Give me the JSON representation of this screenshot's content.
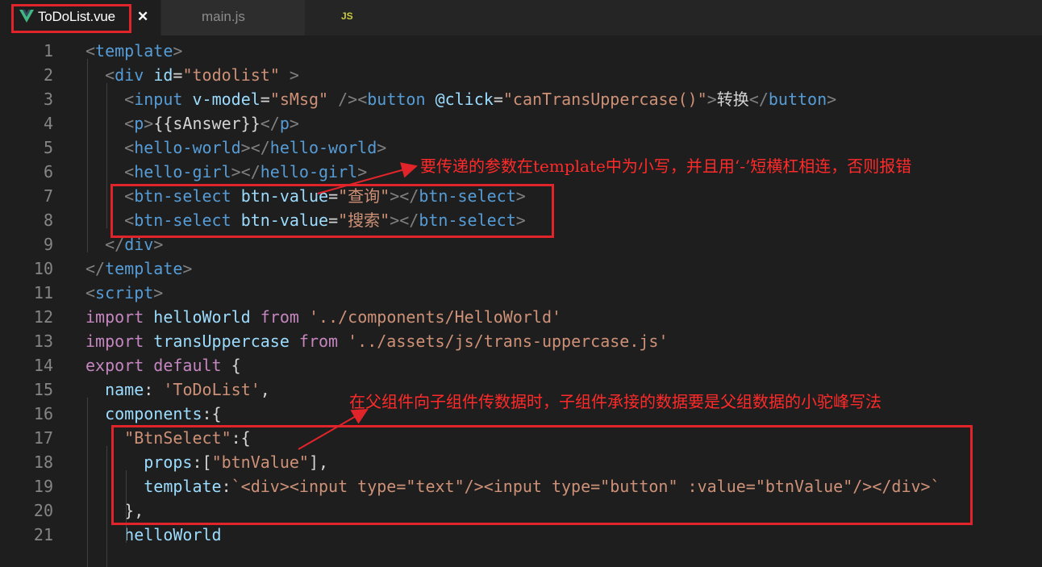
{
  "tabs": [
    {
      "label": "ToDoList.vue",
      "icon": "vue-icon",
      "active": true,
      "close_glyph": "✕"
    },
    {
      "label": "main.js",
      "icon_text": "JS",
      "active": false
    }
  ],
  "colors": {
    "editor_bg": "#1e1e1e",
    "annotation_red": "#e0242a",
    "tag": "#569cd6",
    "attribute": "#9cdcfe",
    "string": "#ce9178",
    "keyword": "#c586c0"
  },
  "code_lines": [
    {
      "n": "1",
      "tokens": [
        [
          "t-punc",
          "<"
        ],
        [
          "t-tag",
          "template"
        ],
        [
          "t-punc",
          ">"
        ]
      ]
    },
    {
      "n": "2",
      "tokens": [
        [
          "t-txt",
          "  "
        ],
        [
          "t-punc",
          "<"
        ],
        [
          "t-tag",
          "div"
        ],
        [
          "t-txt",
          " "
        ],
        [
          "t-attr",
          "id"
        ],
        [
          "t-txt",
          "="
        ],
        [
          "t-str",
          "\"todolist\""
        ],
        [
          "t-txt",
          " "
        ],
        [
          "t-punc",
          ">"
        ]
      ]
    },
    {
      "n": "3",
      "tokens": [
        [
          "t-txt",
          "    "
        ],
        [
          "t-punc",
          "<"
        ],
        [
          "t-tag",
          "input"
        ],
        [
          "t-txt",
          " "
        ],
        [
          "t-attr",
          "v-model"
        ],
        [
          "t-txt",
          "="
        ],
        [
          "t-str",
          "\"sMsg\""
        ],
        [
          "t-txt",
          " "
        ],
        [
          "t-punc",
          "/>"
        ],
        [
          "t-punc",
          "<"
        ],
        [
          "t-tag",
          "button"
        ],
        [
          "t-txt",
          " "
        ],
        [
          "t-attr",
          "@click"
        ],
        [
          "t-txt",
          "="
        ],
        [
          "t-str",
          "\"canTransUppercase()\""
        ],
        [
          "t-punc",
          ">"
        ],
        [
          "t-txt",
          "转换"
        ],
        [
          "t-punc",
          "</"
        ],
        [
          "t-tag",
          "button"
        ],
        [
          "t-punc",
          ">"
        ]
      ]
    },
    {
      "n": "4",
      "tokens": [
        [
          "t-txt",
          "    "
        ],
        [
          "t-punc",
          "<"
        ],
        [
          "t-tag",
          "p"
        ],
        [
          "t-punc",
          ">"
        ],
        [
          "t-txt",
          "{{sAnswer}}"
        ],
        [
          "t-punc",
          "</"
        ],
        [
          "t-tag",
          "p"
        ],
        [
          "t-punc",
          ">"
        ]
      ]
    },
    {
      "n": "5",
      "tokens": [
        [
          "t-txt",
          "    "
        ],
        [
          "t-punc",
          "<"
        ],
        [
          "t-tag",
          "hello-world"
        ],
        [
          "t-punc",
          "></"
        ],
        [
          "t-tag",
          "hello-world"
        ],
        [
          "t-punc",
          ">"
        ]
      ]
    },
    {
      "n": "6",
      "tokens": [
        [
          "t-txt",
          "    "
        ],
        [
          "t-punc",
          "<"
        ],
        [
          "t-tag",
          "hello-girl"
        ],
        [
          "t-punc",
          "></"
        ],
        [
          "t-tag",
          "hello-girl"
        ],
        [
          "t-punc",
          ">"
        ]
      ]
    },
    {
      "n": "7",
      "tokens": [
        [
          "t-txt",
          "    "
        ],
        [
          "t-punc",
          "<"
        ],
        [
          "t-tag",
          "btn-select"
        ],
        [
          "t-txt",
          " "
        ],
        [
          "t-attr",
          "btn-value"
        ],
        [
          "t-txt",
          "="
        ],
        [
          "t-str",
          "\"查询\""
        ],
        [
          "t-punc",
          "></"
        ],
        [
          "t-tag",
          "btn-select"
        ],
        [
          "t-punc",
          ">"
        ]
      ]
    },
    {
      "n": "8",
      "tokens": [
        [
          "t-txt",
          "    "
        ],
        [
          "t-punc",
          "<"
        ],
        [
          "t-tag",
          "btn-select"
        ],
        [
          "t-txt",
          " "
        ],
        [
          "t-attr",
          "btn-value"
        ],
        [
          "t-txt",
          "="
        ],
        [
          "t-str",
          "\"搜索\""
        ],
        [
          "t-punc",
          "></"
        ],
        [
          "t-tag",
          "btn-select"
        ],
        [
          "t-punc",
          ">"
        ]
      ]
    },
    {
      "n": "9",
      "tokens": [
        [
          "t-txt",
          "  "
        ],
        [
          "t-punc",
          "</"
        ],
        [
          "t-tag",
          "div"
        ],
        [
          "t-punc",
          ">"
        ]
      ]
    },
    {
      "n": "10",
      "tokens": [
        [
          "t-punc",
          "</"
        ],
        [
          "t-tag",
          "template"
        ],
        [
          "t-punc",
          ">"
        ]
      ]
    },
    {
      "n": "11",
      "tokens": [
        [
          "t-punc",
          "<"
        ],
        [
          "t-tag",
          "script"
        ],
        [
          "t-punc",
          ">"
        ]
      ]
    },
    {
      "n": "12",
      "tokens": [
        [
          "t-kw",
          "import"
        ],
        [
          "t-txt",
          " "
        ],
        [
          "t-id",
          "helloWorld"
        ],
        [
          "t-txt",
          " "
        ],
        [
          "t-kw",
          "from"
        ],
        [
          "t-txt",
          " "
        ],
        [
          "t-str",
          "'../components/HelloWorld'"
        ]
      ]
    },
    {
      "n": "13",
      "tokens": [
        [
          "t-kw",
          "import"
        ],
        [
          "t-txt",
          " "
        ],
        [
          "t-id",
          "transUppercase"
        ],
        [
          "t-txt",
          " "
        ],
        [
          "t-kw",
          "from"
        ],
        [
          "t-txt",
          " "
        ],
        [
          "t-str",
          "'../assets/js/trans-uppercase.js'"
        ]
      ]
    },
    {
      "n": "14",
      "tokens": [
        [
          "t-kw",
          "export"
        ],
        [
          "t-txt",
          " "
        ],
        [
          "t-kw",
          "default"
        ],
        [
          "t-txt",
          " {"
        ]
      ]
    },
    {
      "n": "15",
      "tokens": [
        [
          "t-txt",
          "  "
        ],
        [
          "t-id",
          "name"
        ],
        [
          "t-txt",
          ": "
        ],
        [
          "t-str",
          "'ToDoList'"
        ],
        [
          "t-txt",
          ","
        ]
      ]
    },
    {
      "n": "16",
      "tokens": [
        [
          "t-txt",
          "  "
        ],
        [
          "t-id",
          "components"
        ],
        [
          "t-txt",
          ":{"
        ]
      ]
    },
    {
      "n": "17",
      "tokens": [
        [
          "t-txt",
          "    "
        ],
        [
          "t-str",
          "\"BtnSelect\""
        ],
        [
          "t-txt",
          ":{"
        ]
      ]
    },
    {
      "n": "18",
      "tokens": [
        [
          "t-txt",
          "      "
        ],
        [
          "t-id",
          "props"
        ],
        [
          "t-txt",
          ":["
        ],
        [
          "t-str",
          "\"btnValue\""
        ],
        [
          "t-txt",
          "],"
        ]
      ]
    },
    {
      "n": "19",
      "tokens": [
        [
          "t-txt",
          "      "
        ],
        [
          "t-id",
          "template"
        ],
        [
          "t-txt",
          ":"
        ],
        [
          "t-str",
          "`<div><input type=\"text\"/><input type=\"button\" :value=\"btnValue\"/></div>`"
        ]
      ]
    },
    {
      "n": "20",
      "tokens": [
        [
          "t-txt",
          "    },"
        ]
      ]
    },
    {
      "n": "21",
      "tokens": [
        [
          "t-txt",
          "    "
        ],
        [
          "t-id",
          "helloWorld"
        ]
      ]
    }
  ],
  "annotations": {
    "note_1": "要传递的参数在template中为小写，并且用‘-’短横杠相连，否则报错",
    "note_2": "在父组件向子组件传数据时，子组件承接的数据要是父组数据的小驼峰写法"
  }
}
